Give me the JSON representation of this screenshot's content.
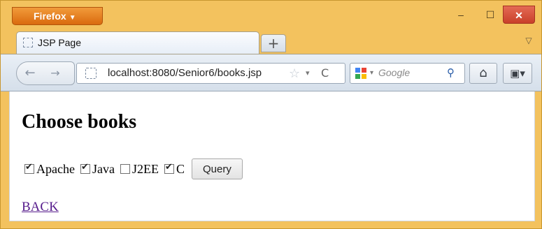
{
  "browser": {
    "menu_button": "Firefox",
    "menu_arrow": "▼",
    "window_controls": {
      "minimize": "–",
      "maximize": "☐",
      "close": "✕"
    },
    "tab": {
      "title": "JSP Page",
      "icon": "blank-page-icon"
    },
    "new_tab": "+",
    "tab_list_arrow": "▽",
    "nav": {
      "back": "←",
      "forward": "→"
    },
    "url": "localhost:8080/Senior6/books.jsp",
    "url_icons": {
      "star": "☆",
      "dropdown": "▾",
      "reload": "C"
    },
    "search": {
      "placeholder": "Google",
      "engine_icon": "google-icon",
      "dropdown": "▾",
      "button": "⚲"
    },
    "home": "⌂",
    "addon": "▣▾"
  },
  "page": {
    "heading": "Choose books",
    "books": [
      {
        "label": "Apache",
        "checked": true
      },
      {
        "label": "Java",
        "checked": true
      },
      {
        "label": "J2EE",
        "checked": false
      },
      {
        "label": "C",
        "checked": true
      }
    ],
    "query_button": "Query",
    "back_link": "BACK"
  }
}
